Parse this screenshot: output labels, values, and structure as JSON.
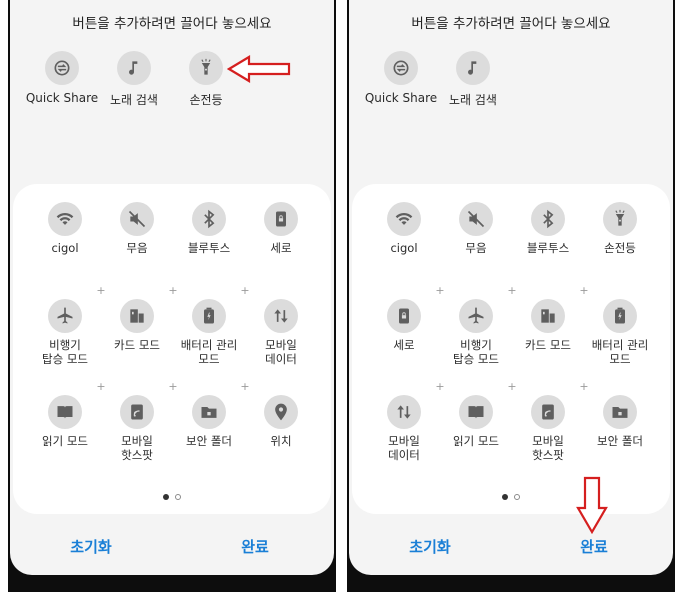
{
  "accent_color": "#1a7fd6",
  "annotation_color": "#d51f1f",
  "left": {
    "hint": "버튼을 추가하려면 끌어다 놓으세요",
    "tray": [
      {
        "label": "Quick Share",
        "icon": "quick-share-icon"
      },
      {
        "label": "노래 검색",
        "icon": "music-note-icon"
      },
      {
        "label": "손전등",
        "icon": "flashlight-icon"
      }
    ],
    "grid": [
      {
        "label": "cigol",
        "icon": "wifi-icon"
      },
      {
        "label": "무음",
        "icon": "mute-icon"
      },
      {
        "label": "블루투스",
        "icon": "bluetooth-icon"
      },
      {
        "label": "세로",
        "icon": "portrait-lock-icon"
      },
      {
        "label": "비행기\n탑승 모드",
        "icon": "airplane-icon"
      },
      {
        "label": "카드 모드",
        "icon": "card-mode-icon"
      },
      {
        "label": "배터리 관리\n모드",
        "icon": "battery-icon"
      },
      {
        "label": "모바일\n데이터",
        "icon": "mobile-data-icon"
      },
      {
        "label": "읽기 모드",
        "icon": "book-icon"
      },
      {
        "label": "모바일\n핫스팟",
        "icon": "hotspot-icon"
      },
      {
        "label": "보안 폴더",
        "icon": "secure-folder-icon"
      },
      {
        "label": "위치",
        "icon": "location-icon"
      }
    ],
    "reset_label": "초기화",
    "done_label": "완료"
  },
  "right": {
    "hint": "버튼을 추가하려면 끌어다 놓으세요",
    "tray": [
      {
        "label": "Quick Share",
        "icon": "quick-share-icon"
      },
      {
        "label": "노래 검색",
        "icon": "music-note-icon"
      }
    ],
    "grid": [
      {
        "label": "cigol",
        "icon": "wifi-icon"
      },
      {
        "label": "무음",
        "icon": "mute-icon"
      },
      {
        "label": "블루투스",
        "icon": "bluetooth-icon"
      },
      {
        "label": "손전등",
        "icon": "flashlight-icon"
      },
      {
        "label": "세로",
        "icon": "portrait-lock-icon"
      },
      {
        "label": "비행기\n탑승 모드",
        "icon": "airplane-icon"
      },
      {
        "label": "카드 모드",
        "icon": "card-mode-icon"
      },
      {
        "label": "배터리 관리\n모드",
        "icon": "battery-icon"
      },
      {
        "label": "모바일\n데이터",
        "icon": "mobile-data-icon"
      },
      {
        "label": "읽기 모드",
        "icon": "book-icon"
      },
      {
        "label": "모바일\n핫스팟",
        "icon": "hotspot-icon"
      },
      {
        "label": "보안 폴더",
        "icon": "secure-folder-icon"
      }
    ],
    "reset_label": "초기화",
    "done_label": "완료"
  }
}
